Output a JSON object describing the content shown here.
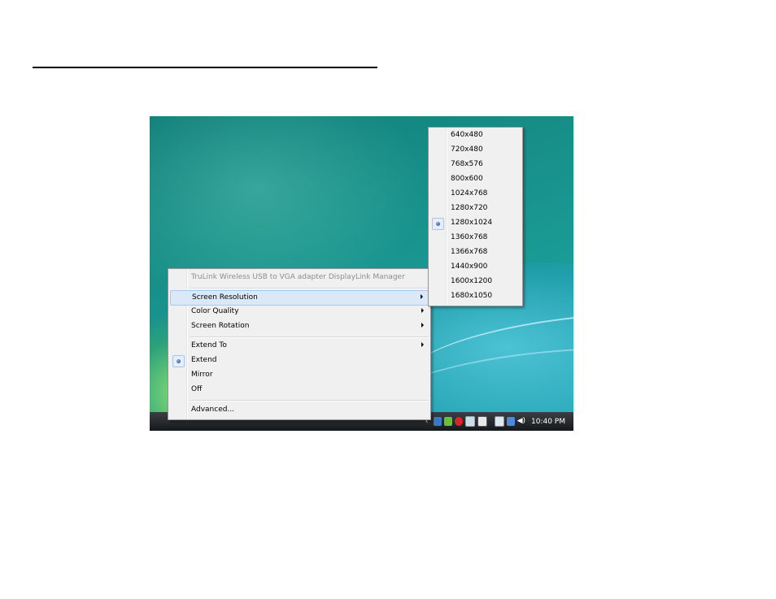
{
  "context_menu": {
    "header": "TruLink Wireless USB to VGA adapter DisplayLink Manager",
    "items": [
      {
        "label": "Screen Resolution",
        "submenu": true,
        "highlighted": true
      },
      {
        "label": "Color Quality",
        "submenu": true
      },
      {
        "label": "Screen Rotation",
        "submenu": true
      },
      {
        "label": "Extend To",
        "submenu": true
      },
      {
        "label": "Extend",
        "selected": true
      },
      {
        "label": "Mirror"
      },
      {
        "label": "Off"
      },
      {
        "label": "Advanced..."
      }
    ]
  },
  "resolution_submenu": {
    "options": [
      "640x480",
      "720x480",
      "768x576",
      "800x600",
      "1024x768",
      "1280x720",
      "1280x1024",
      "1360x768",
      "1366x768",
      "1440x900",
      "1600x1200",
      "1680x1050"
    ],
    "selected": "1280x1024"
  },
  "taskbar": {
    "clock": "10:40 PM",
    "tray_icons": [
      "show-hidden-icons-chevron",
      "network-icon",
      "displaylink-icon",
      "antivirus-icon",
      "device-icon",
      "app-icon",
      "safely-remove-icon",
      "network-status-icon",
      "volume-icon"
    ]
  },
  "colors": {
    "menu_bg": "#f0f0f0",
    "highlight": "#dbe8f8",
    "taskbar": "#1f2226"
  }
}
